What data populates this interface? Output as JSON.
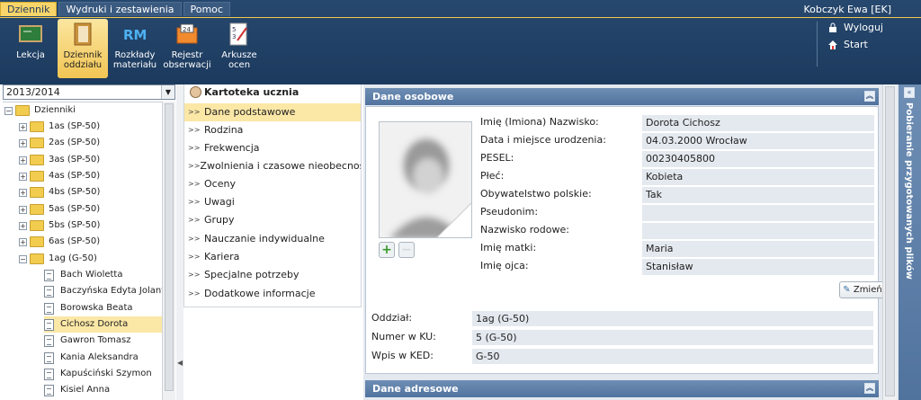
{
  "menu": {
    "tabs": [
      "Dziennik",
      "Wydruki i zestawienia",
      "Pomoc"
    ]
  },
  "user": {
    "name": "Kobczyk Ewa [EK]"
  },
  "toolbar": [
    {
      "label": "Lekcja",
      "icon": "lesson-icon"
    },
    {
      "label": "Dziennik oddziału",
      "icon": "journal-icon"
    },
    {
      "label": "Rozkłady materiału",
      "icon": "rm-icon"
    },
    {
      "label": "Rejestr obserwacji",
      "icon": "register-icon"
    },
    {
      "label": "Arkusze ocen",
      "icon": "grades-sheet-icon"
    }
  ],
  "top_links": {
    "logout": "Wyloguj",
    "start": "Start"
  },
  "year_select": {
    "value": "2013/2014"
  },
  "tree": {
    "root": "Dzienniki",
    "classes": [
      "1as (SP-50)",
      "2as (SP-50)",
      "3as (SP-50)",
      "4as (SP-50)",
      "4bs (SP-50)",
      "5as (SP-50)",
      "5bs (SP-50)",
      "6as (SP-50)",
      "1ag (G-50)"
    ],
    "students": [
      "Bach Wioletta",
      "Baczyńska Edyta Jolanta",
      "Borowska Beata",
      "Cichosz Dorota",
      "Gawron Tomasz",
      "Kania Aleksandra",
      "Kapuściński Szymon",
      "Kisiel Anna"
    ],
    "selected": "Cichosz Dorota"
  },
  "nav": {
    "title": "Kartoteka ucznia",
    "items": [
      "Dane podstawowe",
      "Rodzina",
      "Frekwencja",
      "Zwolnienia i czasowe nieobecności",
      "Oceny",
      "Uwagi",
      "Grupy",
      "Nauczanie indywidualne",
      "Kariera",
      "Specjalne potrzeby",
      "Dodatkowe informacje"
    ],
    "selected": "Dane podstawowe"
  },
  "personal": {
    "header": "Dane osobowe",
    "fields": [
      {
        "label": "Imię (Imiona) Nazwisko:",
        "value": "Dorota Cichosz"
      },
      {
        "label": "Data i miejsce urodzenia:",
        "value": "04.03.2000 Wrocław"
      },
      {
        "label": "PESEL:",
        "value": "00230405800"
      },
      {
        "label": "Płeć:",
        "value": "Kobieta"
      },
      {
        "label": "Obywatelstwo polskie:",
        "value": "Tak"
      },
      {
        "label": "Pseudonim:",
        "value": ""
      },
      {
        "label": "Nazwisko rodowe:",
        "value": ""
      },
      {
        "label": "Imię matki:",
        "value": "Maria"
      },
      {
        "label": "Imię ojca:",
        "value": "Stanisław"
      }
    ],
    "edit_button": "Zmień"
  },
  "class_info": [
    {
      "label": "Oddział:",
      "value": "1ag (G-50)"
    },
    {
      "label": "Numer w KU:",
      "value": "5 (G-50)"
    },
    {
      "label": "Wpis w KED:",
      "value": "G-50"
    }
  ],
  "address": {
    "header": "Dane adresowe"
  },
  "side_panel": {
    "label": "Pobieranie przygotowanych plików"
  }
}
